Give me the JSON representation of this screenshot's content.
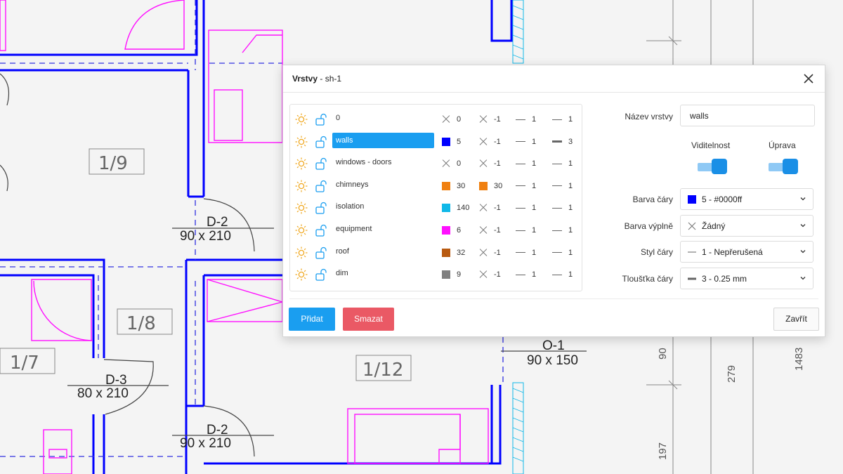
{
  "dialog": {
    "title": "Vrstvy",
    "subtitle": " - sh-1"
  },
  "layers": [
    {
      "name": "0",
      "color_mode": "none",
      "color_value": "0",
      "fill_mode": "none",
      "fill_value": "-1",
      "style": "1",
      "width": "1",
      "width_thick": false,
      "selected": false
    },
    {
      "name": "walls",
      "color_mode": "swatch",
      "color": "#0000ff",
      "color_value": "5",
      "fill_mode": "none",
      "fill_value": "-1",
      "style": "1",
      "width": "3",
      "width_thick": true,
      "selected": true
    },
    {
      "name": "windows - doors",
      "color_mode": "none",
      "color_value": "0",
      "fill_mode": "none",
      "fill_value": "-1",
      "style": "1",
      "width": "1",
      "width_thick": false,
      "selected": false
    },
    {
      "name": "chimneys",
      "color_mode": "swatch",
      "color": "#f08010",
      "color_value": "30",
      "fill_mode": "swatch",
      "fill": "#f08010",
      "fill_value": "30",
      "style": "1",
      "width": "1",
      "width_thick": false,
      "selected": false
    },
    {
      "name": "isolation",
      "color_mode": "swatch",
      "color": "#10b8e8",
      "color_value": "140",
      "fill_mode": "none",
      "fill_value": "-1",
      "style": "1",
      "width": "1",
      "width_thick": false,
      "selected": false
    },
    {
      "name": "equipment",
      "color_mode": "swatch",
      "color": "#ff10ff",
      "color_value": "6",
      "fill_mode": "none",
      "fill_value": "-1",
      "style": "1",
      "width": "1",
      "width_thick": false,
      "selected": false
    },
    {
      "name": "roof",
      "color_mode": "swatch",
      "color": "#b85a10",
      "color_value": "32",
      "fill_mode": "none",
      "fill_value": "-1",
      "style": "1",
      "width": "1",
      "width_thick": false,
      "selected": false
    },
    {
      "name": "dim",
      "color_mode": "swatch",
      "color": "#808080",
      "color_value": "9",
      "fill_mode": "none",
      "fill_value": "-1",
      "style": "1",
      "width": "1",
      "width_thick": false,
      "selected": false
    }
  ],
  "form": {
    "name_label": "Název vrstvy",
    "name_value": "walls",
    "visibility_label": "Viditelnost",
    "edit_label": "Úprava",
    "line_color_label": "Barva čáry",
    "line_color_value": "5 - #0000ff",
    "line_color_swatch": "#0000ff",
    "fill_color_label": "Barva výplně",
    "fill_color_value": "Žádný",
    "line_style_label": "Styl čáry",
    "line_style_value": "1 - Nepřerušená",
    "line_width_label": "Tloušťka čáry",
    "line_width_value": "3 - 0.25 mm",
    "visibility_on": true,
    "edit_on": true
  },
  "buttons": {
    "add": "Přidat",
    "delete": "Smazat",
    "close": "Zavřít"
  },
  "plan": {
    "rooms": [
      "1/9",
      "1/8",
      "1/7",
      "1/12"
    ],
    "doors": [
      {
        "id": "D-2",
        "size": "90 x 210"
      },
      {
        "id": "D-3",
        "size": "80 x 210"
      },
      {
        "id": "D-2",
        "size": "90 x 210"
      }
    ],
    "window": {
      "id": "O-1",
      "size": "90 x 150"
    },
    "dims": [
      "90",
      "279",
      "1483",
      "197"
    ]
  },
  "colors": {
    "wall": "#0000ff",
    "equipment": "#ff10ff",
    "isolation": "#10b8e8",
    "accent": "#1a9ef0",
    "danger": "#ea5965"
  }
}
